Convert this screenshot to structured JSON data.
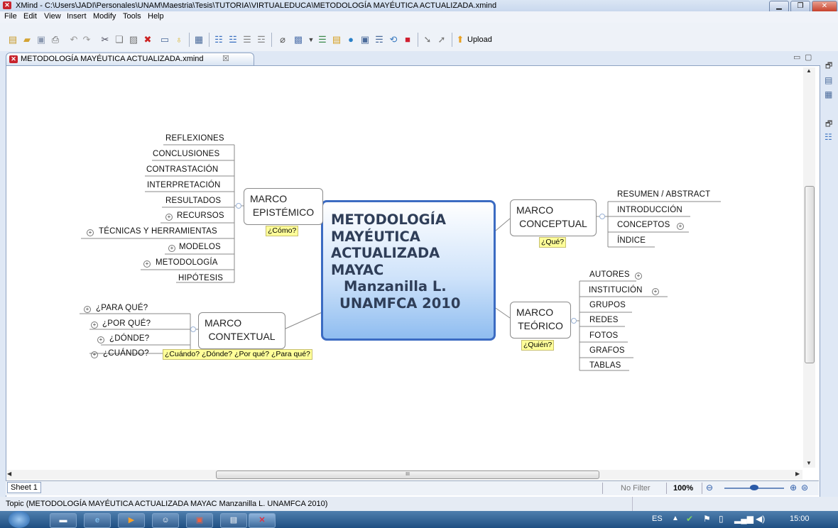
{
  "window": {
    "title": "XMind - C:\\Users\\JADI\\Personales\\UNAM\\Maestria\\Tesis\\TUTORIA\\VIRTUALEDUCA\\METODOLOGÍA MAYÉUTICA ACTUALIZADA.xmind",
    "app_icon": "xmind-icon",
    "controls": [
      "minimize-icon",
      "restore-icon",
      "close-icon"
    ]
  },
  "menu": [
    "File",
    "Edit",
    "View",
    "Insert",
    "Modify",
    "Tools",
    "Help"
  ],
  "toolbar": {
    "upload_label": "Upload"
  },
  "editor_tab": {
    "label": "METODOLOGÍA MAYÉUTICA ACTUALIZADA.xmind",
    "close": "☒"
  },
  "mindmap": {
    "central": [
      "METODOLOGÍA",
      "MAYÉUTICA",
      "ACTUALIZADA",
      "MAYAC",
      "Manzanilla L.",
      "UNAMFCA 2010"
    ],
    "epistemico": {
      "title": [
        "MARCO",
        "EPISTÉMICO"
      ],
      "note": "¿Cómo?",
      "children": [
        "REFLEXIONES",
        "CONCLUSIONES",
        "CONTRASTACIÓN",
        "INTERPRETACIÓN",
        "RESULTADOS",
        "RECURSOS",
        "TÉCNICAS Y HERRAMIENTAS",
        "MODELOS",
        "METODOLOGÍA",
        "HIPÓTESIS"
      ]
    },
    "contextual": {
      "title": [
        "MARCO",
        "CONTEXTUAL"
      ],
      "note": "¿Cuándo? ¿Dónde? ¿Por qué? ¿Para qué?",
      "children": [
        "¿PARA QUÉ?",
        "¿POR QUÉ?",
        "¿DÓNDE?",
        "¿CUÁNDO?"
      ]
    },
    "conceptual": {
      "title": [
        "MARCO",
        "CONCEPTUAL"
      ],
      "note": "¿Qué?",
      "children": [
        "RESUMEN / ABSTRACT",
        "INTRODUCCIÓN",
        "CONCEPTOS",
        "ÍNDICE"
      ]
    },
    "teorico": {
      "title": [
        "MARCO",
        "TEÓRICO"
      ],
      "note": "¿Quién?",
      "children": [
        "AUTORES",
        "INSTITUCIÓN",
        "GRUPOS",
        "REDES",
        "FOTOS",
        "GRAFOS",
        "TABLAS"
      ]
    }
  },
  "hscroll_label": "III",
  "sheet": {
    "tab": "Sheet 1",
    "filter": "No Filter",
    "zoom": "100%"
  },
  "status": "Topic (METODOLOGÍA MAYÉUTICA ACTUALIZADA MAYAC Manzanilla L.  UNAMFCA 2010)",
  "taskbar": {
    "lang": "ES",
    "time": "15:00"
  }
}
